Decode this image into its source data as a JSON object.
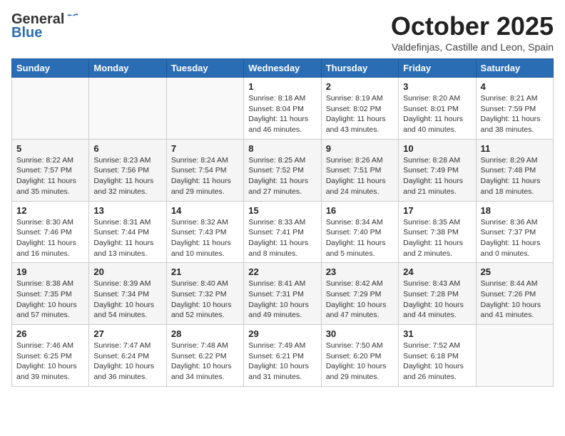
{
  "header": {
    "logo_general": "General",
    "logo_blue": "Blue",
    "month_title": "October 2025",
    "subtitle": "Valdefinjas, Castille and Leon, Spain"
  },
  "weekdays": [
    "Sunday",
    "Monday",
    "Tuesday",
    "Wednesday",
    "Thursday",
    "Friday",
    "Saturday"
  ],
  "weeks": [
    [
      {
        "day": null,
        "info": null
      },
      {
        "day": null,
        "info": null
      },
      {
        "day": null,
        "info": null
      },
      {
        "day": "1",
        "info": "Sunrise: 8:18 AM\nSunset: 8:04 PM\nDaylight: 11 hours\nand 46 minutes."
      },
      {
        "day": "2",
        "info": "Sunrise: 8:19 AM\nSunset: 8:02 PM\nDaylight: 11 hours\nand 43 minutes."
      },
      {
        "day": "3",
        "info": "Sunrise: 8:20 AM\nSunset: 8:01 PM\nDaylight: 11 hours\nand 40 minutes."
      },
      {
        "day": "4",
        "info": "Sunrise: 8:21 AM\nSunset: 7:59 PM\nDaylight: 11 hours\nand 38 minutes."
      }
    ],
    [
      {
        "day": "5",
        "info": "Sunrise: 8:22 AM\nSunset: 7:57 PM\nDaylight: 11 hours\nand 35 minutes."
      },
      {
        "day": "6",
        "info": "Sunrise: 8:23 AM\nSunset: 7:56 PM\nDaylight: 11 hours\nand 32 minutes."
      },
      {
        "day": "7",
        "info": "Sunrise: 8:24 AM\nSunset: 7:54 PM\nDaylight: 11 hours\nand 29 minutes."
      },
      {
        "day": "8",
        "info": "Sunrise: 8:25 AM\nSunset: 7:52 PM\nDaylight: 11 hours\nand 27 minutes."
      },
      {
        "day": "9",
        "info": "Sunrise: 8:26 AM\nSunset: 7:51 PM\nDaylight: 11 hours\nand 24 minutes."
      },
      {
        "day": "10",
        "info": "Sunrise: 8:28 AM\nSunset: 7:49 PM\nDaylight: 11 hours\nand 21 minutes."
      },
      {
        "day": "11",
        "info": "Sunrise: 8:29 AM\nSunset: 7:48 PM\nDaylight: 11 hours\nand 18 minutes."
      }
    ],
    [
      {
        "day": "12",
        "info": "Sunrise: 8:30 AM\nSunset: 7:46 PM\nDaylight: 11 hours\nand 16 minutes."
      },
      {
        "day": "13",
        "info": "Sunrise: 8:31 AM\nSunset: 7:44 PM\nDaylight: 11 hours\nand 13 minutes."
      },
      {
        "day": "14",
        "info": "Sunrise: 8:32 AM\nSunset: 7:43 PM\nDaylight: 11 hours\nand 10 minutes."
      },
      {
        "day": "15",
        "info": "Sunrise: 8:33 AM\nSunset: 7:41 PM\nDaylight: 11 hours\nand 8 minutes."
      },
      {
        "day": "16",
        "info": "Sunrise: 8:34 AM\nSunset: 7:40 PM\nDaylight: 11 hours\nand 5 minutes."
      },
      {
        "day": "17",
        "info": "Sunrise: 8:35 AM\nSunset: 7:38 PM\nDaylight: 11 hours\nand 2 minutes."
      },
      {
        "day": "18",
        "info": "Sunrise: 8:36 AM\nSunset: 7:37 PM\nDaylight: 11 hours\nand 0 minutes."
      }
    ],
    [
      {
        "day": "19",
        "info": "Sunrise: 8:38 AM\nSunset: 7:35 PM\nDaylight: 10 hours\nand 57 minutes."
      },
      {
        "day": "20",
        "info": "Sunrise: 8:39 AM\nSunset: 7:34 PM\nDaylight: 10 hours\nand 54 minutes."
      },
      {
        "day": "21",
        "info": "Sunrise: 8:40 AM\nSunset: 7:32 PM\nDaylight: 10 hours\nand 52 minutes."
      },
      {
        "day": "22",
        "info": "Sunrise: 8:41 AM\nSunset: 7:31 PM\nDaylight: 10 hours\nand 49 minutes."
      },
      {
        "day": "23",
        "info": "Sunrise: 8:42 AM\nSunset: 7:29 PM\nDaylight: 10 hours\nand 47 minutes."
      },
      {
        "day": "24",
        "info": "Sunrise: 8:43 AM\nSunset: 7:28 PM\nDaylight: 10 hours\nand 44 minutes."
      },
      {
        "day": "25",
        "info": "Sunrise: 8:44 AM\nSunset: 7:26 PM\nDaylight: 10 hours\nand 41 minutes."
      }
    ],
    [
      {
        "day": "26",
        "info": "Sunrise: 7:46 AM\nSunset: 6:25 PM\nDaylight: 10 hours\nand 39 minutes."
      },
      {
        "day": "27",
        "info": "Sunrise: 7:47 AM\nSunset: 6:24 PM\nDaylight: 10 hours\nand 36 minutes."
      },
      {
        "day": "28",
        "info": "Sunrise: 7:48 AM\nSunset: 6:22 PM\nDaylight: 10 hours\nand 34 minutes."
      },
      {
        "day": "29",
        "info": "Sunrise: 7:49 AM\nSunset: 6:21 PM\nDaylight: 10 hours\nand 31 minutes."
      },
      {
        "day": "30",
        "info": "Sunrise: 7:50 AM\nSunset: 6:20 PM\nDaylight: 10 hours\nand 29 minutes."
      },
      {
        "day": "31",
        "info": "Sunrise: 7:52 AM\nSunset: 6:18 PM\nDaylight: 10 hours\nand 26 minutes."
      },
      {
        "day": null,
        "info": null
      }
    ]
  ]
}
